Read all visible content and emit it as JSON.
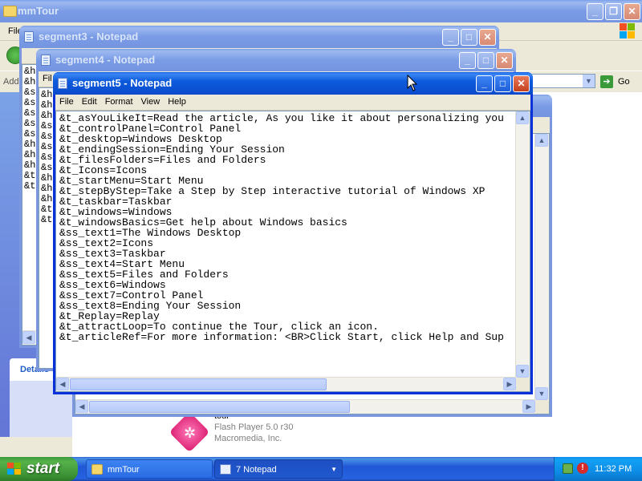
{
  "explorer": {
    "title": "mmTour",
    "menu_partial": "File",
    "address_label": "Addr",
    "go_label": "Go",
    "left_panel_button": "Details",
    "details": {
      "name": "tour",
      "type": "Flash Player 5.0 r30",
      "company": "Macromedia, Inc."
    }
  },
  "windows": {
    "seg3_title": "segment3 - Notepad",
    "seg4_title": "segment4 - Notepad",
    "seg5_title": "segment5 - Notepad",
    "seg4_partial_menu": "Fil",
    "seg3_lines": [
      "&h",
      "&h",
      "&s",
      "&s",
      "&s",
      "&s",
      "&s",
      "&h",
      "&h",
      "&h",
      "&t",
      "&t"
    ],
    "seg4_lines": [
      "&h",
      "&h",
      "&h",
      "&s",
      "&s",
      "&s",
      "&s",
      "&s",
      "&h",
      "&h",
      "&h",
      "&t",
      "&t"
    ]
  },
  "notepad": {
    "menu": [
      "File",
      "Edit",
      "Format",
      "View",
      "Help"
    ],
    "lines": [
      "&t_asYouLikeIt=Read the article, As you like it about personalizing you",
      "&t_controlPanel=Control Panel",
      "&t_desktop=Windows Desktop",
      "&t_endingSession=Ending Your Session",
      "&t_filesFolders=Files and Folders",
      "&t_Icons=Icons",
      "&t_startMenu=Start Menu",
      "&t_stepByStep=Take a Step by Step interactive tutorial of Windows XP",
      "&t_taskbar=Taskbar",
      "&t_windows=Windows",
      "&t_windowsBasics=Get help about Windows basics",
      "&ss_text1=The Windows Desktop",
      "&ss_text2=Icons",
      "&ss_text3=Taskbar",
      "&ss_text4=Start Menu",
      "&ss_text5=Files and Folders",
      "&ss_text6=Windows",
      "&ss_text7=Control Panel",
      "&ss_text8=Ending Your Session",
      "&t_Replay=Replay",
      "&t_attractLoop=To continue the Tour, click an icon.",
      "&t_articleRef=For more information: <BR>Click Start, click Help and Sup"
    ]
  },
  "taskbar": {
    "start_label": "start",
    "items": [
      "mmTour",
      "7 Notepad"
    ],
    "clock": "11:32 PM"
  },
  "colors": {
    "titlebar_active": "#0a4fd0",
    "taskbar": "#245edb",
    "start_green": "#3c9a3c"
  }
}
